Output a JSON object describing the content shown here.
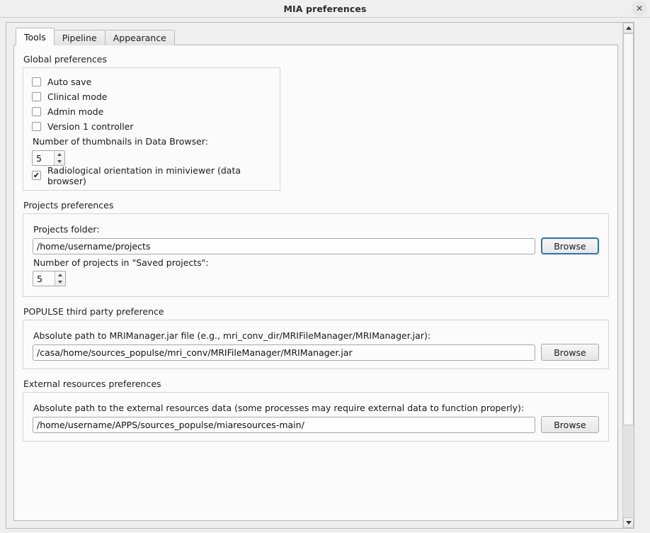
{
  "window": {
    "title": "MIA preferences",
    "close_label": "✕"
  },
  "tabs": [
    {
      "label": "Tools",
      "selected": true
    },
    {
      "label": "Pipeline",
      "selected": false
    },
    {
      "label": "Appearance",
      "selected": false
    }
  ],
  "global_preferences": {
    "title": "Global preferences",
    "checkboxes": [
      {
        "label": "Auto save",
        "checked": false
      },
      {
        "label": "Clinical mode",
        "checked": false
      },
      {
        "label": "Admin mode",
        "checked": false
      },
      {
        "label": "Version 1 controller",
        "checked": false
      }
    ],
    "thumbnails_label": "Number of thumbnails in Data Browser:",
    "thumbnails_value": "5",
    "radiological": {
      "label": "Radiological orientation in miniviewer (data browser)",
      "checked": true
    }
  },
  "projects_preferences": {
    "title": "Projects preferences",
    "folder_label": "Projects folder:",
    "folder_value": "/home/username/projects",
    "folder_browse": "Browse",
    "saved_label": "Number of projects in \"Saved projects\":",
    "saved_value": "5"
  },
  "populse_preferences": {
    "title": "POPULSE third party preference",
    "path_label": "Absolute path to MRIManager.jar file (e.g., mri_conv_dir/MRIFileManager/MRIManager.jar):",
    "path_value": "/casa/home/sources_populse/mri_conv/MRIFileManager/MRIManager.jar",
    "browse": "Browse"
  },
  "external_preferences": {
    "title": "External resources preferences",
    "path_label": "Absolute path to the external resources data (some processes may require external data to function properly):",
    "path_value": "/home/username/APPS/sources_populse/miaresources-main/",
    "browse": "Browse"
  },
  "scrollbar": {
    "up_name": "scroll-up-arrow",
    "down_name": "scroll-down-arrow"
  },
  "colors": {
    "focus_border": "#2f6fb5",
    "window_bg": "#efefef",
    "panel_bg": "#fbfbfb"
  }
}
